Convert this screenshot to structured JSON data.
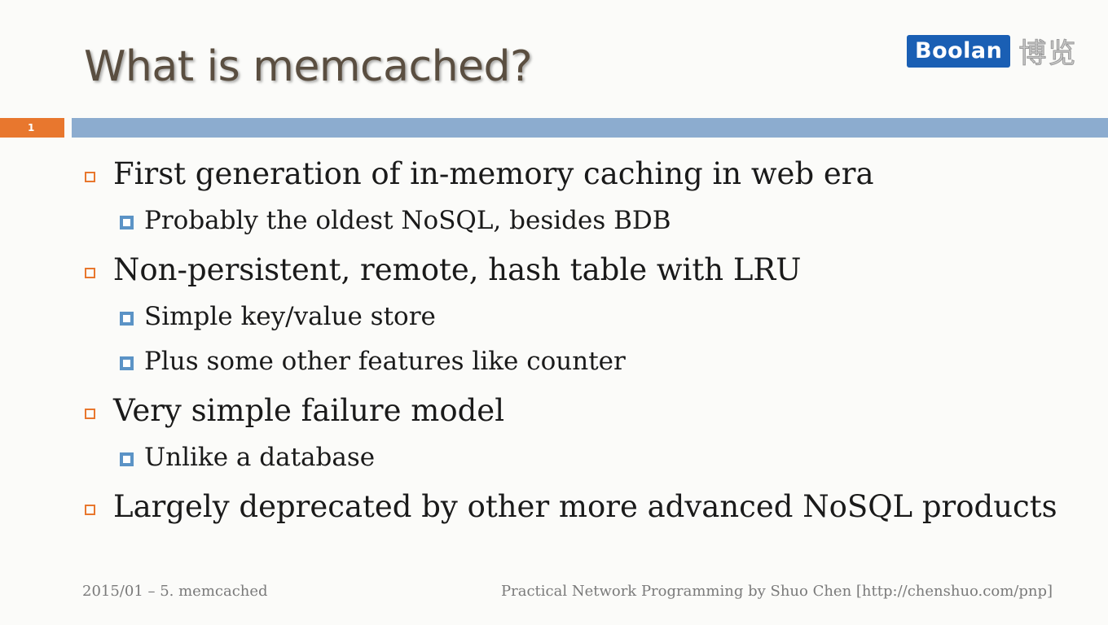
{
  "slide": {
    "title": "What is memcached?",
    "page_number": "1",
    "logo": {
      "brand": "Boolan",
      "chinese": "博览",
      "brand_color": "#1a5fb4"
    },
    "colors": {
      "title": "#5a4e40",
      "accent_orange": "#e8772e",
      "rule_blue": "#8caccf",
      "bullet_blue": "#5b93c6"
    },
    "bullets": [
      {
        "text": "First generation of in-memory caching in web era",
        "sub": [
          "Probably the oldest NoSQL, besides BDB"
        ]
      },
      {
        "text": "Non-persistent, remote, hash table with LRU",
        "sub": [
          "Simple key/value store",
          "Plus some other features like counter"
        ]
      },
      {
        "text": "Very simple failure model",
        "sub": [
          "Unlike a database"
        ]
      },
      {
        "text": "Largely deprecated by other more advanced NoSQL products",
        "sub": []
      }
    ],
    "footer": {
      "left": "2015/01 – 5. memcached",
      "right": "Practical Network Programming by Shuo Chen [http://chenshuo.com/pnp]"
    }
  }
}
